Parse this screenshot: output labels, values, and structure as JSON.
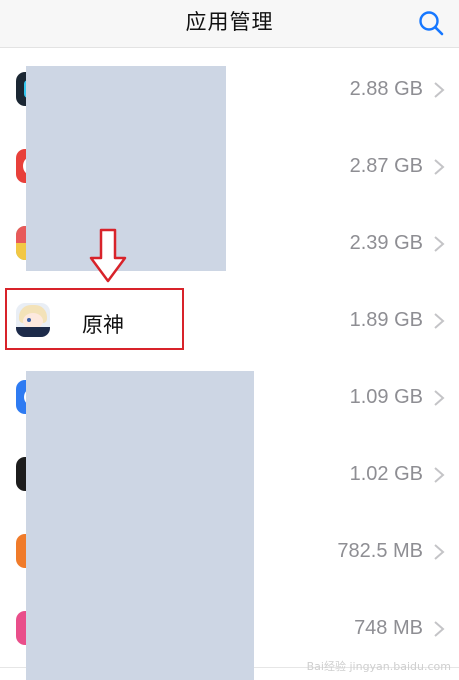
{
  "header": {
    "title": "应用管理",
    "search_icon": "search-icon"
  },
  "apps": [
    {
      "name": "",
      "size": "2.88 GB",
      "icon_color": "#1b2733"
    },
    {
      "name": "",
      "size": "2.87 GB",
      "icon_color": "#e8403a"
    },
    {
      "name": "",
      "size": "2.39 GB",
      "icon_color": "#6cc57a"
    },
    {
      "name": "原神",
      "size": "1.89 GB",
      "icon_color": "#9cc2e8"
    },
    {
      "name": "",
      "size": "1.09 GB",
      "icon_color": "#2e7bf2"
    },
    {
      "name": "",
      "size": "1.02 GB",
      "icon_color": "#1c1c1c"
    },
    {
      "name": "",
      "size": "782.5 MB",
      "icon_color": "#f07b2a"
    },
    {
      "name": "",
      "size": "748 MB",
      "icon_color": "#e94e8a"
    }
  ],
  "annotation": {
    "highlight_color": "#d8232a",
    "arrow": "down-arrow"
  },
  "watermark": "Bai经验 jingyan.baidu.com"
}
